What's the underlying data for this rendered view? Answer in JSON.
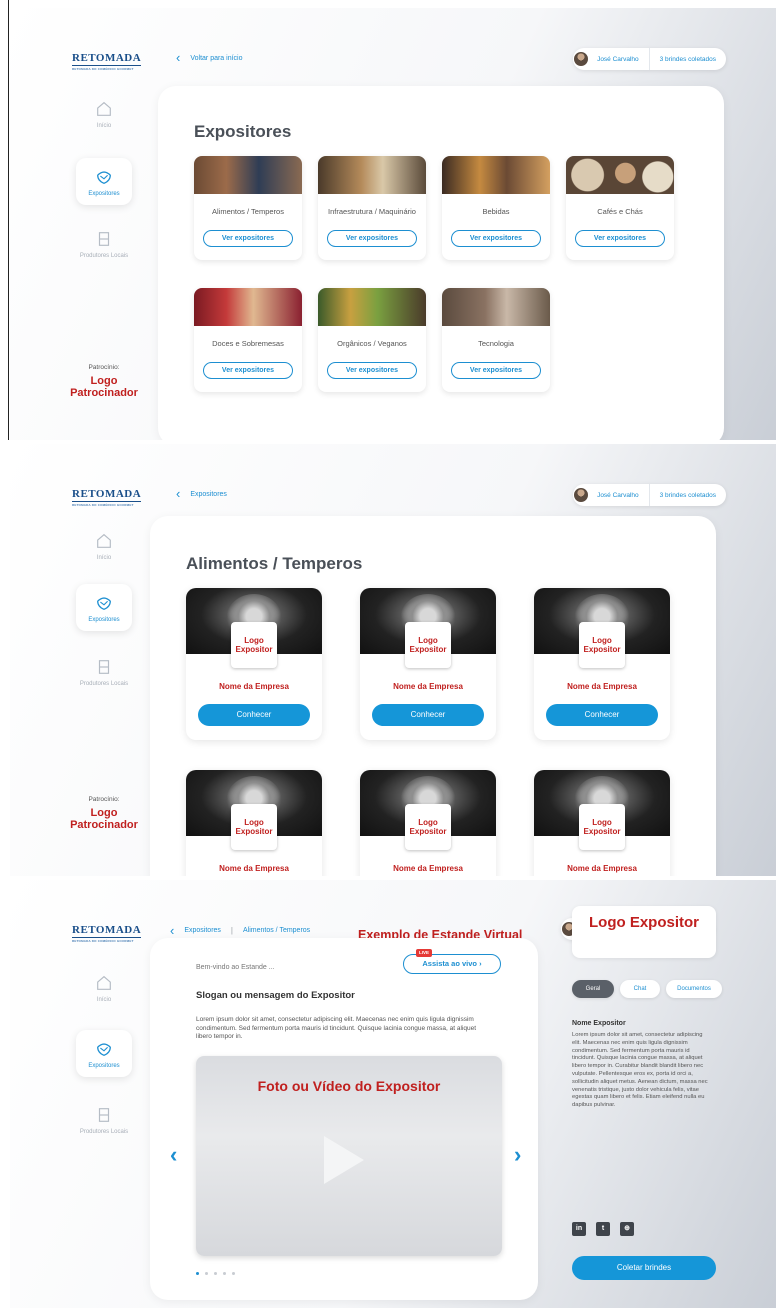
{
  "brand": {
    "logo": "RETOMADA",
    "logo_sub": "RETOMADA DO COMÉRCIO GOURMET"
  },
  "user": {
    "name": "José Carvalho",
    "brindes": "3 brindes coletados"
  },
  "sidebar": {
    "inicio": "Início",
    "expositores": "Expositores",
    "produtores": "Produtores Locais"
  },
  "sponsor": {
    "label": "Patrocínio:",
    "name": "Logo Patrocinador"
  },
  "screen1": {
    "back_label": "Voltar para início",
    "title": "Expositores",
    "button_label": "Ver expositores",
    "categories": [
      {
        "name": "Alimentos / Temperos"
      },
      {
        "name": "Infraestrutura / Maquinário"
      },
      {
        "name": "Bebidas"
      },
      {
        "name": "Cafés e Chás"
      },
      {
        "name": "Doces e Sobremesas"
      },
      {
        "name": "Orgânicos / Veganos"
      },
      {
        "name": "Tecnologia"
      }
    ]
  },
  "screen2": {
    "breadcrumb": "Expositores",
    "title": "Alimentos / Temperos",
    "logo_text": "Logo Expositor",
    "company": "Nome da Empresa",
    "button_label": "Conhecer"
  },
  "screen3": {
    "breadcrumb_1": "Expositores",
    "breadcrumb_2": "Alimentos / Temperos",
    "title": "Exemplo de Estande Virtual",
    "welcome": "Bem-vindo ao Estande ...",
    "live_badge": "LIVE",
    "live_button": "Assista ao vivo",
    "slogan": "Slogan ou mensagem do Expositor",
    "lorem": "Lorem ipsum dolor sit amet, consectetur adipiscing elit. Maecenas nec enim quis ligula dignissim condimentum. Sed fermentum porta mauris id tincidunt. Quisque lacinia congue massa, at aliquet libero tempor in.",
    "media_title": "Foto ou Vídeo do Expositor",
    "logo_text": "Logo Expositor",
    "tabs": [
      "Geral",
      "Chat",
      "Documentos"
    ],
    "exhibitor_name": "Nome Expositor",
    "description": "Lorem ipsum dolor sit amet, consectetur adipiscing elit. Maecenas nec enim quis ligula dignissim condimentum. Sed fermentum porta mauris id tincidunt. Quisque lacinia congue massa, at aliquet libero tempor in. Curabitur blandit blandit libero nec vulputate. Pellentesque eros ex, porta id orci a, sollicitudin aliquet metus. Aenean dictum, massa nec venenatis tristique, justo dolor vehicula felis, vitae egestas quam libero et felis. Etiam eleifend nulla eu dapibus pulvinar.",
    "social": [
      "in",
      "t",
      "⊕"
    ],
    "collect_button": "Coletar brindes"
  }
}
